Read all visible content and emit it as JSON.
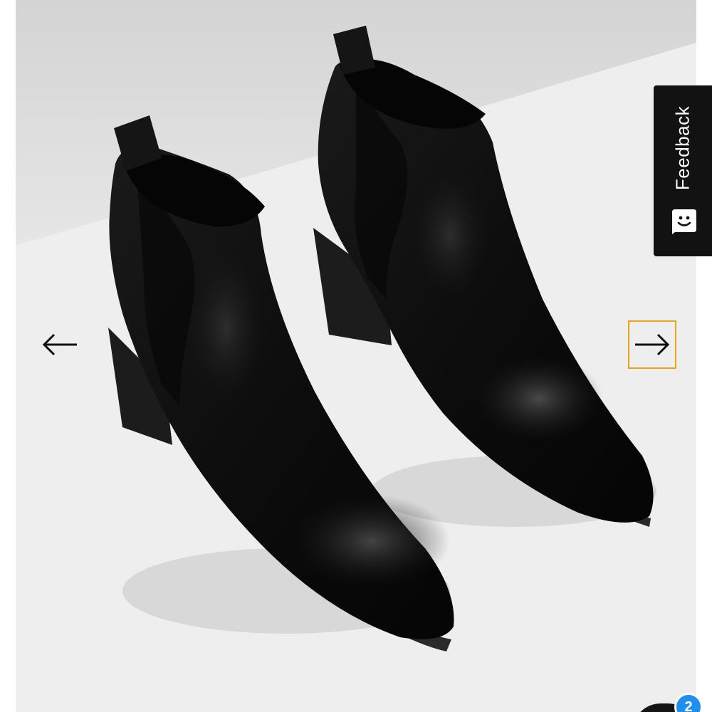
{
  "gallery": {
    "image_alt_icon": "ankle-boots-photo",
    "prev_icon": "arrow-left-icon",
    "next_icon": "arrow-right-icon",
    "focus_color": "#e8a417"
  },
  "feedback": {
    "label": "Feedback",
    "icon": "smiley-chat-icon",
    "background": "#121212"
  },
  "chat": {
    "badge_count": "2",
    "badge_color": "#1e8ff0"
  }
}
